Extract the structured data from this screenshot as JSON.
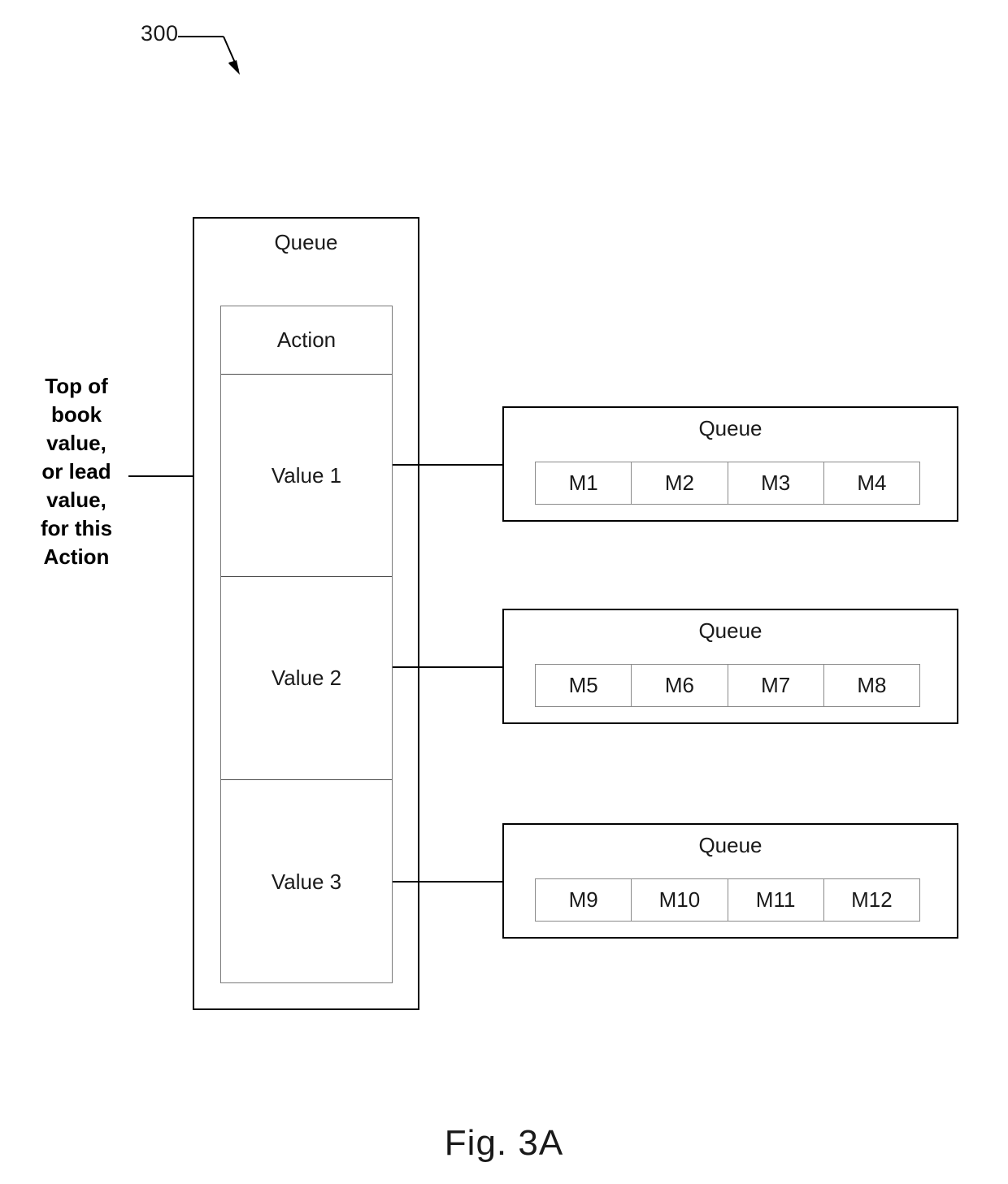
{
  "figure": {
    "reference_numeral": "300",
    "caption": "Fig. 3A"
  },
  "annotation": {
    "text": "Top of book value, or lead value, for this Action",
    "lines": [
      "Top of",
      "book",
      "value,",
      "or lead",
      "value,",
      "for this",
      "Action"
    ]
  },
  "main_queue": {
    "title": "Queue",
    "action_label": "Action",
    "values": [
      {
        "label": "Value 1"
      },
      {
        "label": "Value 2"
      },
      {
        "label": "Value 3"
      }
    ]
  },
  "message_queues": [
    {
      "title": "Queue",
      "messages": [
        "M1",
        "M2",
        "M3",
        "M4"
      ]
    },
    {
      "title": "Queue",
      "messages": [
        "M5",
        "M6",
        "M7",
        "M8"
      ]
    },
    {
      "title": "Queue",
      "messages": [
        "M9",
        "M10",
        "M11",
        "M12"
      ]
    }
  ],
  "colors": {
    "line": "#000000",
    "text": "#1a1a1a",
    "inner_border": "#7a7a7a",
    "background": "#ffffff"
  }
}
